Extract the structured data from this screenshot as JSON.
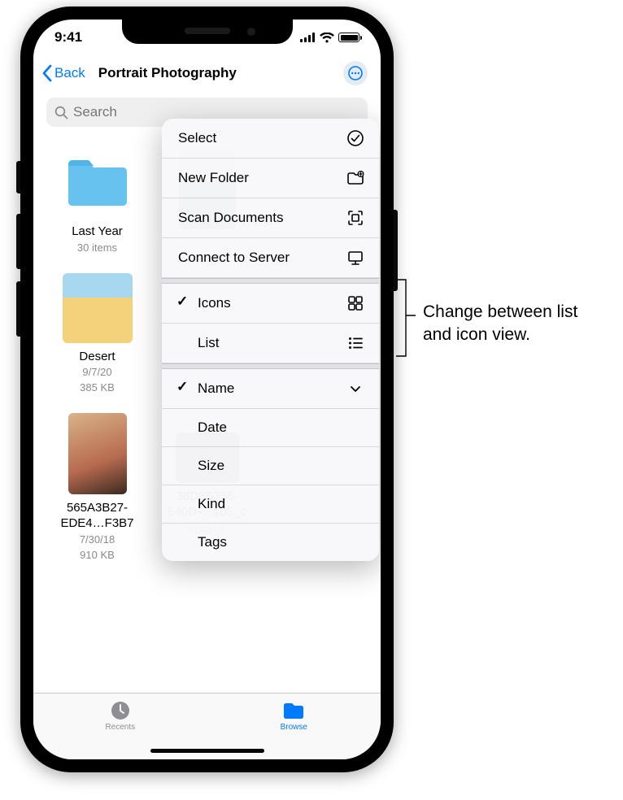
{
  "status": {
    "time": "9:41"
  },
  "nav": {
    "back": "Back",
    "title": "Portrait Photography"
  },
  "search": {
    "placeholder": "Search"
  },
  "items": [
    {
      "name": "Last Year",
      "subtitle": "30 items",
      "date": "",
      "size": ""
    },
    {
      "name": "",
      "subtitle": "",
      "date": "",
      "size": ""
    },
    {
      "name": "",
      "subtitle": "",
      "date": "",
      "size": ""
    },
    {
      "name": "Desert",
      "subtitle": "",
      "date": "9/7/20",
      "size": "385 KB"
    },
    {
      "name": "",
      "subtitle": "",
      "date": "",
      "size": ""
    },
    {
      "name": "",
      "subtitle": "",
      "date": "",
      "size": ""
    },
    {
      "name": "565A3B27-EDE4…F3B7",
      "subtitle": "",
      "date": "7/30/18",
      "size": "910 KB"
    },
    {
      "name": "38DE5356-540D-…105_c",
      "subtitle": "",
      "date": "8/16/19",
      "size": "363 KB"
    }
  ],
  "menu": {
    "actions": {
      "select": "Select",
      "new_folder": "New Folder",
      "scan": "Scan Documents",
      "connect": "Connect to Server"
    },
    "view": {
      "icons": "Icons",
      "list": "List"
    },
    "sort": {
      "name": "Name",
      "date": "Date",
      "size": "Size",
      "kind": "Kind",
      "tags": "Tags"
    }
  },
  "tabs": {
    "recents": "Recents",
    "browse": "Browse"
  },
  "callout": "Change between list and icon view."
}
